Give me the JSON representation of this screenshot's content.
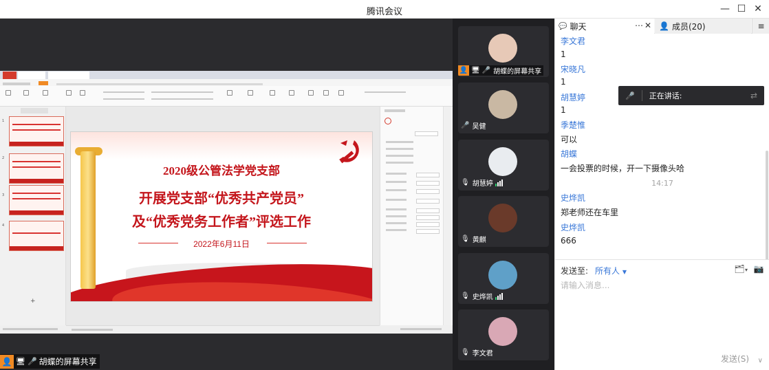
{
  "window": {
    "title": "腾讯会议"
  },
  "stage": {
    "presenter_label": "胡蝶的屏幕共享"
  },
  "shared_slide": {
    "org": "2020级公管法学党支部",
    "headline1": "开展党支部“优秀共产党员”",
    "headline2": "及“优秀党务工作者”评选工作",
    "date": "2022年6月11日"
  },
  "video_tiles": [
    {
      "name": "胡蝶的屏幕共享",
      "kind": "screen-share",
      "avatar_color": "#e7c9b7"
    },
    {
      "name": "吴健",
      "kind": "muted",
      "avatar_color": "#c9b8a3"
    },
    {
      "name": "胡慧婷",
      "kind": "muted",
      "avatar_color": "#e9ecf0"
    },
    {
      "name": "黄麒",
      "kind": "muted",
      "avatar_color": "#6a3a2a"
    },
    {
      "name": "史烨凯",
      "kind": "muted",
      "avatar_color": "#5fa0c8"
    },
    {
      "name": "李文君",
      "kind": "muted",
      "avatar_color": "#d9a8b5"
    }
  ],
  "chat": {
    "tab_chat": "聊天",
    "tab_members": "成员(20)",
    "speaking_label": "正在讲话:",
    "messages": [
      {
        "sender": "李文君",
        "text": "1"
      },
      {
        "sender": "宋晓凡",
        "text": "1"
      },
      {
        "sender": "胡慧婷",
        "text": "1"
      },
      {
        "sender": "季楚惟",
        "text": "可以"
      },
      {
        "sender": "胡蝶",
        "text": "一会投票的时候，开一下摄像头哈"
      },
      {
        "sender": "史烨凯",
        "text": "郑老师还在车里"
      },
      {
        "sender": "史烨凯",
        "text": "666"
      }
    ],
    "timestamp": "14:17",
    "send_to_label": "发送至:",
    "send_to_value": "所有人",
    "input_placeholder": "请输入消息...",
    "send_button": "发送(S)"
  },
  "colors": {
    "accent_blue": "#3a78d8",
    "slide_red": "#c4161c",
    "stage_bg": "#2b2b2e",
    "speaker_orange": "#f08a24"
  }
}
